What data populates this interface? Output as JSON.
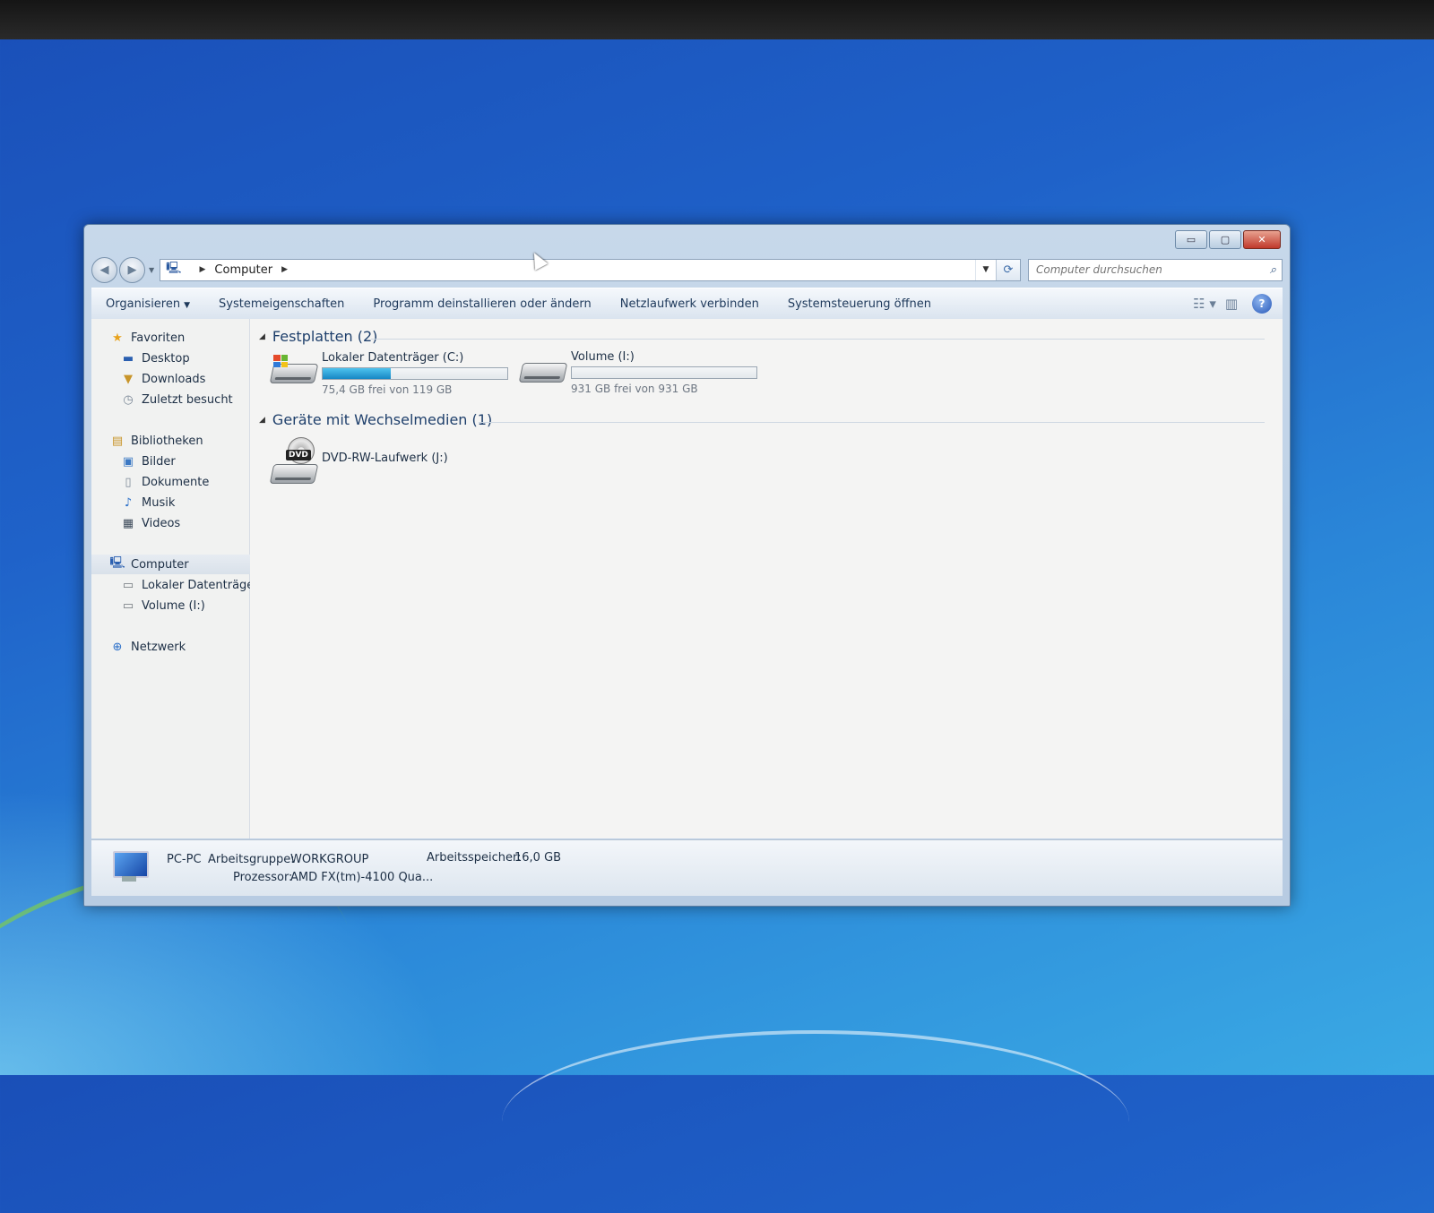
{
  "window": {
    "controls": {
      "minimize": "▭",
      "maximize": "▢",
      "close": "✕"
    }
  },
  "address": {
    "path": [
      "Computer"
    ],
    "search_placeholder": "Computer durchsuchen"
  },
  "toolbar": {
    "organize": "Organisieren",
    "system_properties": "Systemeigenschaften",
    "uninstall": "Programm deinstallieren oder ändern",
    "map_drive": "Netzlaufwerk verbinden",
    "control_panel": "Systemsteuerung öffnen",
    "icons": {
      "view": "view-options-icon",
      "preview": "preview-pane-icon",
      "help": "help-icon"
    }
  },
  "sidebar": {
    "favorites": {
      "label": "Favoriten",
      "items": [
        "Desktop",
        "Downloads",
        "Zuletzt besucht"
      ]
    },
    "libraries": {
      "label": "Bibliotheken",
      "items": [
        "Bilder",
        "Dokumente",
        "Musik",
        "Videos"
      ]
    },
    "computer": {
      "label": "Computer",
      "items": [
        "Lokaler Datenträger",
        "Volume (I:)"
      ]
    },
    "network": {
      "label": "Netzwerk"
    }
  },
  "content": {
    "hard_drives": {
      "header": "Festplatten (2)",
      "drives": [
        {
          "name": "Lokaler Datenträger (C:)",
          "free_text": "75,4 GB frei von 119 GB",
          "used_fraction": 0.37,
          "icon": "windows-drive-icon"
        },
        {
          "name": "Volume (I:)",
          "free_text": "931 GB frei von 931 GB",
          "used_fraction": 0.0,
          "icon": "hard-drive-icon"
        }
      ]
    },
    "removable": {
      "header": "Geräte mit Wechselmedien (1)",
      "devices": [
        {
          "name": "DVD-RW-Laufwerk (J:)",
          "icon": "dvd-drive-icon"
        }
      ]
    }
  },
  "details": {
    "computer_name": "PC-PC",
    "workgroup_label": "Arbeitsgruppe:",
    "workgroup": "WORKGROUP",
    "memory_label": "Arbeitsspeicher:",
    "memory": "16,0 GB",
    "processor_label": "Prozessor:",
    "processor": "AMD FX(tm)-4100 Qua..."
  },
  "colors": {
    "bar_fill": "#1e93cf",
    "accent": "#1e3f6b",
    "close_button": "#c0392b"
  }
}
